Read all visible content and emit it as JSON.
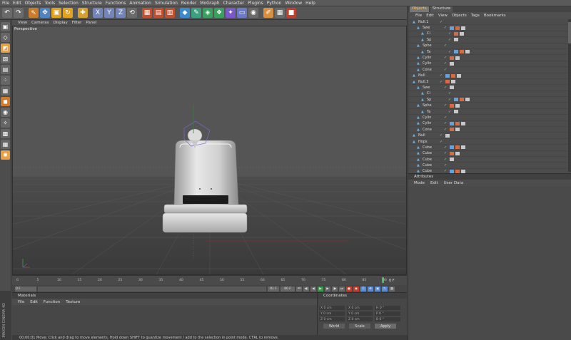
{
  "menu": [
    "File",
    "Edit",
    "Objects",
    "Tools",
    "Selection",
    "Structure",
    "Functions",
    "Animation",
    "Simulation",
    "Render",
    "MoGraph",
    "Character",
    "Plugins",
    "Python",
    "Window",
    "Help"
  ],
  "viewport": {
    "menu": [
      "View",
      "Cameras",
      "Display",
      "Filter",
      "Panel"
    ],
    "label": "Perspective"
  },
  "timeline": {
    "ticks": [
      "0",
      "5",
      "10",
      "15",
      "20",
      "25",
      "30",
      "35",
      "40",
      "45",
      "50",
      "55",
      "60",
      "65",
      "70",
      "75",
      "80",
      "85",
      "90"
    ],
    "current_frame": "0 F",
    "start_field": "0 F",
    "end_field": "90 F",
    "range_end": "91 F"
  },
  "materials": {
    "title": "Materials",
    "menu": [
      "File",
      "Edit",
      "Function",
      "Texture"
    ]
  },
  "coordinates": {
    "title": "Coordinates",
    "rows": [
      {
        "a": "X  0 cm",
        "b": "X  0 cm",
        "c": "H  0 °"
      },
      {
        "a": "Y  0 cm",
        "b": "Y  0 cm",
        "c": "P  0 °"
      },
      {
        "a": "Z  0 cm",
        "b": "Z  0 cm",
        "c": "B  0 °"
      }
    ],
    "mode1": "World",
    "mode2": "Scale",
    "apply": "Apply"
  },
  "right": {
    "tabs": [
      "Objects",
      "Structure"
    ],
    "menu": [
      "File",
      "Edit",
      "View",
      "Objects",
      "Tags",
      "Bookmarks"
    ],
    "objects": [
      "Null.1",
      "Swe",
      "Ci",
      "Sp",
      "Sphe",
      "Ta",
      "Cylin",
      "Cylin",
      "Cone",
      "Null",
      "Null.3",
      "Swe",
      "Ci",
      "Sp",
      "Sphe",
      "Ta",
      "Cylin",
      "Cylin",
      "Cone",
      "Null",
      "Hops",
      "Cube",
      "Cube",
      "Cube",
      "Cube",
      "Cube",
      "Cube"
    ],
    "attributes": {
      "title": "Attributes",
      "menu": [
        "Mode",
        "Edit",
        "User Data"
      ]
    }
  },
  "status": "00:00:01   Move: Click and drag to move elements. Hold down SHIFT to quantize movement / add to the selection in point mode. CTRL to remove.",
  "brand": "MAXON CINEMA 4D"
}
